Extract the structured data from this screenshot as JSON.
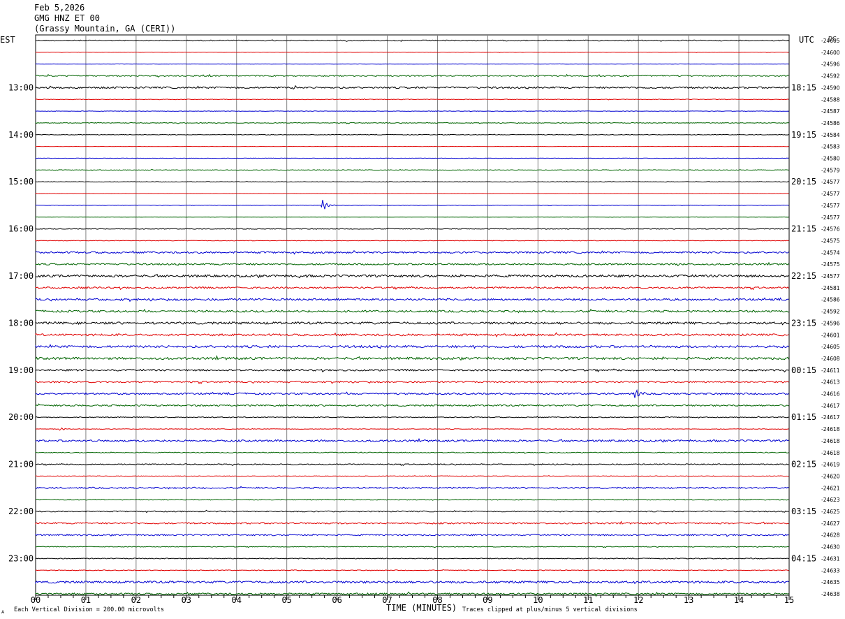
{
  "header": {
    "date": "Feb 5,2026",
    "channel": "GMG HNZ ET 00",
    "station": "(Grassy Mountain, GA (CERI))"
  },
  "labels": {
    "left_zone": "EST",
    "right_zone": "UTC",
    "dc": "DC",
    "xlabel": "TIME (MINUTES)",
    "scale_note": "Each Vertical Division =  200.00 microvolts",
    "clip_note": "Traces clipped at plus/minus 5 vertical divisions",
    "corner_mark": "A"
  },
  "colors": {
    "trace_cycle": [
      "#000000",
      "#e00000",
      "#0000d0",
      "#006400"
    ],
    "grid": "#808080"
  },
  "chart_data": {
    "type": "line",
    "title": "GMG HNZ ET 00",
    "xlabel": "TIME (MINUTES)",
    "xlim": [
      0,
      15
    ],
    "x_ticks": [
      "00",
      "01",
      "02",
      "03",
      "04",
      "05",
      "06",
      "07",
      "08",
      "09",
      "10",
      "11",
      "12",
      "13",
      "14",
      "15"
    ],
    "rows": 48,
    "minutes_per_row": 15,
    "left_hour_labels": [
      {
        "row": 4,
        "label": "13:00"
      },
      {
        "row": 8,
        "label": "14:00"
      },
      {
        "row": 12,
        "label": "15:00"
      },
      {
        "row": 16,
        "label": "16:00"
      },
      {
        "row": 20,
        "label": "17:00"
      },
      {
        "row": 24,
        "label": "18:00"
      },
      {
        "row": 28,
        "label": "19:00"
      },
      {
        "row": 32,
        "label": "20:00"
      },
      {
        "row": 36,
        "label": "21:00"
      },
      {
        "row": 40,
        "label": "22:00"
      },
      {
        "row": 44,
        "label": "23:00"
      }
    ],
    "right_hour_labels": [
      {
        "row": 4,
        "label": "18:15"
      },
      {
        "row": 8,
        "label": "19:15"
      },
      {
        "row": 12,
        "label": "20:15"
      },
      {
        "row": 16,
        "label": "21:15"
      },
      {
        "row": 20,
        "label": "22:15"
      },
      {
        "row": 24,
        "label": "23:15"
      },
      {
        "row": 28,
        "label": "00:15"
      },
      {
        "row": 32,
        "label": "01:15"
      },
      {
        "row": 36,
        "label": "02:15"
      },
      {
        "row": 40,
        "label": "03:15"
      },
      {
        "row": 44,
        "label": "04:15"
      }
    ],
    "dc_values": [
      "-24605",
      "-24600",
      "-24596",
      "-24592",
      "-24590",
      "-24588",
      "-24587",
      "-24586",
      "-24584",
      "-24583",
      "-24580",
      "-24579",
      "-24577",
      "-24577",
      "-24577",
      "-24577",
      "-24576",
      "-24575",
      "-24574",
      "-24575",
      "-24577",
      "-24581",
      "-24586",
      "-24592",
      "-24596",
      "-24601",
      "-24605",
      "-24608",
      "-24611",
      "-24613",
      "-24616",
      "-24617",
      "-24617",
      "-24618",
      "-24618",
      "-24618",
      "-24619",
      "-24620",
      "-24621",
      "-24623",
      "-24625",
      "-24627",
      "-24628",
      "-24630",
      "-24631",
      "-24633",
      "-24635",
      "-24638"
    ],
    "noise_level": [
      0.7,
      0.2,
      0.2,
      0.9,
      1.2,
      0.4,
      0.3,
      0.5,
      0.4,
      0.2,
      0.3,
      0.5,
      0.4,
      0.2,
      0.3,
      0.2,
      0.5,
      0.4,
      1.2,
      1.1,
      1.6,
      1.2,
      1.4,
      1.4,
      1.6,
      1.4,
      1.6,
      1.6,
      1.2,
      1.1,
      1.2,
      1.1,
      0.6,
      0.4,
      1.3,
      0.6,
      0.8,
      0.5,
      1.0,
      0.7,
      0.8,
      1.1,
      1.0,
      0.5,
      0.6,
      0.5,
      1.5,
      1.2
    ],
    "events": [
      {
        "row": 14,
        "minute": 5.72,
        "amplitude": 8
      },
      {
        "row": 30,
        "minute": 11.95,
        "amplitude": 6
      },
      {
        "row": 4,
        "minute": 5.15,
        "amplitude": 3
      },
      {
        "row": 20,
        "minute": 5.25,
        "amplitude": 3
      },
      {
        "row": 19,
        "minute": 12.8,
        "amplitude": 2
      },
      {
        "row": 47,
        "minute": 11.15,
        "amplitude": 3
      },
      {
        "row": 26,
        "minute": 8.7,
        "amplitude": 2
      },
      {
        "row": 33,
        "minute": 0.5,
        "amplitude": 2
      }
    ]
  }
}
